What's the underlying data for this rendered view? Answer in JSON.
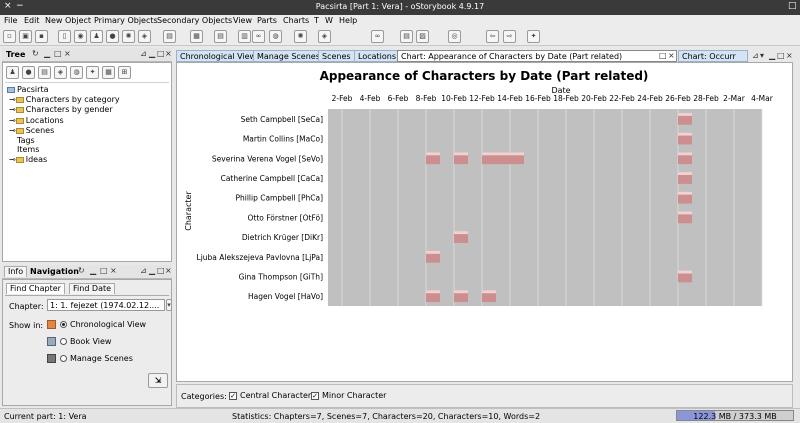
{
  "window": {
    "title": "Pacsirta [Part 1: Vera] - oStorybook 4.9.17",
    "close_glyph": "×",
    "minimize_glyph": "−",
    "maximize_glyph": "□"
  },
  "menu": [
    "File",
    "Edit",
    "New Object",
    "Primary Objects",
    "Secondary Objects",
    "View",
    "Parts",
    "Charts",
    "T",
    "W",
    "Help"
  ],
  "toolbar": {
    "icons": [
      "new-file",
      "open-folder",
      "save",
      "new-doc",
      "person",
      "man",
      "globe",
      "film-reel",
      "tag",
      "chapters",
      "scene-table",
      "person-table",
      "location-table",
      "link",
      "globe-table",
      "reel-table",
      "tag-table",
      "link2",
      "edit-doc",
      "book",
      "memoria",
      "arrow-left",
      "arrow-right",
      "lightbulb"
    ],
    "glyphs": [
      "▫",
      "▣",
      "▪",
      "▯",
      "◉",
      "♟",
      "●",
      "✺",
      "◈",
      "▤",
      "▦",
      "▤",
      "▥",
      "∞",
      "◍",
      "✺",
      "◈",
      "∞",
      "▤",
      "▨",
      "◎",
      "⇦",
      "⇨",
      "✦"
    ]
  },
  "tree_panel": {
    "title": "Tree",
    "root": "Pacsirta",
    "items": [
      {
        "label": "Characters by category",
        "folder": true
      },
      {
        "label": "Characters by gender",
        "folder": true
      },
      {
        "label": "Locations",
        "folder": true
      },
      {
        "label": "Scenes",
        "folder": true
      },
      {
        "label": "Tags",
        "folder": false
      },
      {
        "label": "Items",
        "folder": false
      },
      {
        "label": "Ideas",
        "folder": true
      }
    ]
  },
  "nav_panel": {
    "tab_info": "Info",
    "tab_navigation": "Navigation",
    "subtab_find_chapter": "Find Chapter",
    "subtab_find_date": "Find Date",
    "chapter_label": "Chapter:",
    "chapter_value": "1: 1. fejezet (1974.02.12....",
    "show_in_label": "Show in:",
    "options": [
      "Chronological View",
      "Book View",
      "Manage Scenes"
    ],
    "selected_option": 0
  },
  "doc_tabs": [
    {
      "label": "Chronological View",
      "active": false
    },
    {
      "label": "Manage Scenes",
      "active": false
    },
    {
      "label": "Scenes",
      "active": false
    },
    {
      "label": "Locations",
      "active": false
    },
    {
      "label": "Chart: Appearance of Characters by Date (Part related)",
      "active": true
    },
    {
      "label": "Chart: Occurr",
      "active": false
    }
  ],
  "chart_data": {
    "type": "heatmap",
    "title": "Appearance of Characters by Date (Part related)",
    "xlabel": "Date",
    "ylabel": "Character",
    "x_ticks": [
      "2-Feb",
      "4-Feb",
      "6-Feb",
      "8-Feb",
      "10-Feb",
      "12-Feb",
      "14-Feb",
      "16-Feb",
      "18-Feb",
      "20-Feb",
      "22-Feb",
      "24-Feb",
      "26-Feb",
      "28-Feb",
      "2-Mar",
      "4-Mar"
    ],
    "xlim": [
      "1974-02-01",
      "1974-03-04"
    ],
    "grid": true,
    "characters": [
      "Seth Campbell [SeCa]",
      "Martin Collins [MaCo]",
      "Severina Verena Vogel [SeVo]",
      "Catherine Campbell [CaCa]",
      "Phillip Campbell [PhCa]",
      "Otto Förstner [OtFö]",
      "Dietrich Krüger [DiKr]",
      "Ljuba Alekszejeva Pavlovna [LjPa]",
      "Gina Thompson [GiTh]",
      "Hagen Vogel [HaVo]"
    ],
    "appearances": [
      {
        "character": "Seth Campbell [SeCa]",
        "dates": [
          "1974-02-26"
        ]
      },
      {
        "character": "Martin Collins [MaCo]",
        "dates": [
          "1974-02-26"
        ]
      },
      {
        "character": "Severina Verena Vogel [SeVo]",
        "dates": [
          "1974-02-08",
          "1974-02-10",
          "1974-02-12",
          "1974-02-13",
          "1974-02-14",
          "1974-02-26"
        ]
      },
      {
        "character": "Catherine Campbell [CaCa]",
        "dates": [
          "1974-02-26"
        ]
      },
      {
        "character": "Phillip Campbell [PhCa]",
        "dates": [
          "1974-02-26"
        ]
      },
      {
        "character": "Otto Förstner [OtFö]",
        "dates": [
          "1974-02-26"
        ]
      },
      {
        "character": "Dietrich Krüger [DiKr]",
        "dates": [
          "1974-02-10"
        ]
      },
      {
        "character": "Ljuba Alekszejeva Pavlovna [LjPa]",
        "dates": [
          "1974-02-08"
        ]
      },
      {
        "character": "Gina Thompson [GiTh]",
        "dates": [
          "1974-02-26"
        ]
      },
      {
        "character": "Hagen Vogel [HaVo]",
        "dates": [
          "1974-02-08",
          "1974-02-10",
          "1974-02-12"
        ]
      }
    ],
    "colors": {
      "plot_bg": "#c0c0c0",
      "cell": "#cc8e8e",
      "cell_top": "#f0d2d2",
      "grid": "#dddddd"
    }
  },
  "categories": {
    "label": "Categories:",
    "items": [
      {
        "label": "Central Character",
        "checked": true
      },
      {
        "label": "Minor Character",
        "checked": true
      }
    ]
  },
  "status": {
    "current_part": "Current part: 1: Vera",
    "statistics": "Statistics: Chapters=7,  Scenes=7,  Characters=20,  Characters=10,  Words=2",
    "memory": "122.3 MB / 373.3 MB",
    "memory_used_fraction": 0.328
  }
}
